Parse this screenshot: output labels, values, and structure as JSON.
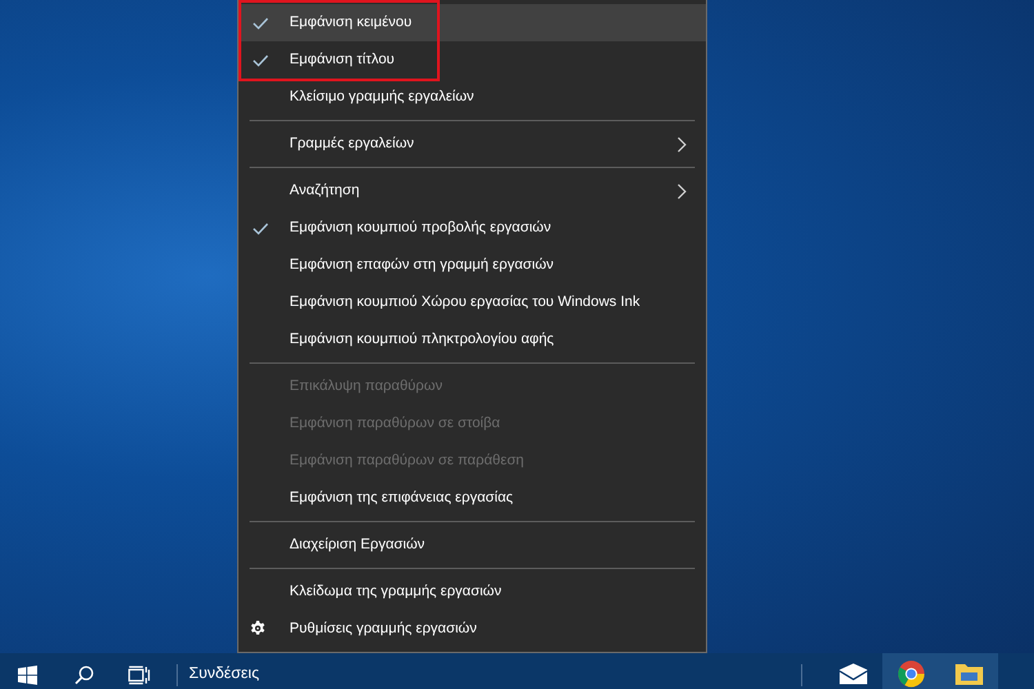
{
  "context_menu": {
    "items": [
      {
        "kind": "item",
        "label": "Εμφάνιση κειμένου",
        "checked": true,
        "disabled": false,
        "selected": true,
        "submenu": false,
        "annotated": true
      },
      {
        "kind": "item",
        "label": "Εμφάνιση τίτλου",
        "checked": true,
        "disabled": false,
        "selected": false,
        "submenu": false,
        "annotated": true
      },
      {
        "kind": "item",
        "label": "Κλείσιμο γραμμής εργαλείων",
        "checked": false,
        "disabled": false,
        "selected": false,
        "submenu": false,
        "annotated": false
      },
      {
        "kind": "separator"
      },
      {
        "kind": "item",
        "label": "Γραμμές εργαλείων",
        "checked": false,
        "disabled": false,
        "selected": false,
        "submenu": true,
        "annotated": false
      },
      {
        "kind": "separator"
      },
      {
        "kind": "item",
        "label": "Αναζήτηση",
        "checked": false,
        "disabled": false,
        "selected": false,
        "submenu": true,
        "annotated": false
      },
      {
        "kind": "item",
        "label": "Εμφάνιση κουμπιού προβολής εργασιών",
        "checked": true,
        "disabled": false,
        "selected": false,
        "submenu": false,
        "annotated": false
      },
      {
        "kind": "item",
        "label": "Εμφάνιση επαφών στη γραμμή εργασιών",
        "checked": false,
        "disabled": false,
        "selected": false,
        "submenu": false,
        "annotated": false
      },
      {
        "kind": "item",
        "label": "Εμφάνιση κουμπιού Χώρου εργασίας του Windows Ink",
        "checked": false,
        "disabled": false,
        "selected": false,
        "submenu": false,
        "annotated": false
      },
      {
        "kind": "item",
        "label": "Εμφάνιση κουμπιού πληκτρολογίου αφής",
        "checked": false,
        "disabled": false,
        "selected": false,
        "submenu": false,
        "annotated": false
      },
      {
        "kind": "separator"
      },
      {
        "kind": "item",
        "label": "Επικάλυψη παραθύρων",
        "checked": false,
        "disabled": true,
        "selected": false,
        "submenu": false,
        "annotated": false
      },
      {
        "kind": "item",
        "label": "Εμφάνιση παραθύρων σε στοίβα",
        "checked": false,
        "disabled": true,
        "selected": false,
        "submenu": false,
        "annotated": false
      },
      {
        "kind": "item",
        "label": "Εμφάνιση παραθύρων σε παράθεση",
        "checked": false,
        "disabled": true,
        "selected": false,
        "submenu": false,
        "annotated": false
      },
      {
        "kind": "item",
        "label": "Εμφάνιση της επιφάνειας εργασίας",
        "checked": false,
        "disabled": false,
        "selected": false,
        "submenu": false,
        "annotated": false
      },
      {
        "kind": "separator"
      },
      {
        "kind": "item",
        "label": "Διαχείριση Εργασιών",
        "checked": false,
        "disabled": false,
        "selected": false,
        "submenu": false,
        "annotated": false
      },
      {
        "kind": "separator"
      },
      {
        "kind": "item",
        "label": "Κλείδωμα της γραμμής εργασιών",
        "checked": false,
        "disabled": false,
        "selected": false,
        "submenu": false,
        "annotated": false
      },
      {
        "kind": "settings",
        "label": "Ρυθμίσεις γραμμής εργασιών",
        "checked": false,
        "disabled": false,
        "selected": false,
        "submenu": false,
        "annotated": false
      }
    ]
  },
  "taskbar": {
    "toolbar_label": "Συνδέσεις",
    "apps": [
      {
        "kind": "mail",
        "running": false
      },
      {
        "kind": "browser",
        "running": true
      },
      {
        "kind": "folder",
        "running": true
      }
    ]
  }
}
